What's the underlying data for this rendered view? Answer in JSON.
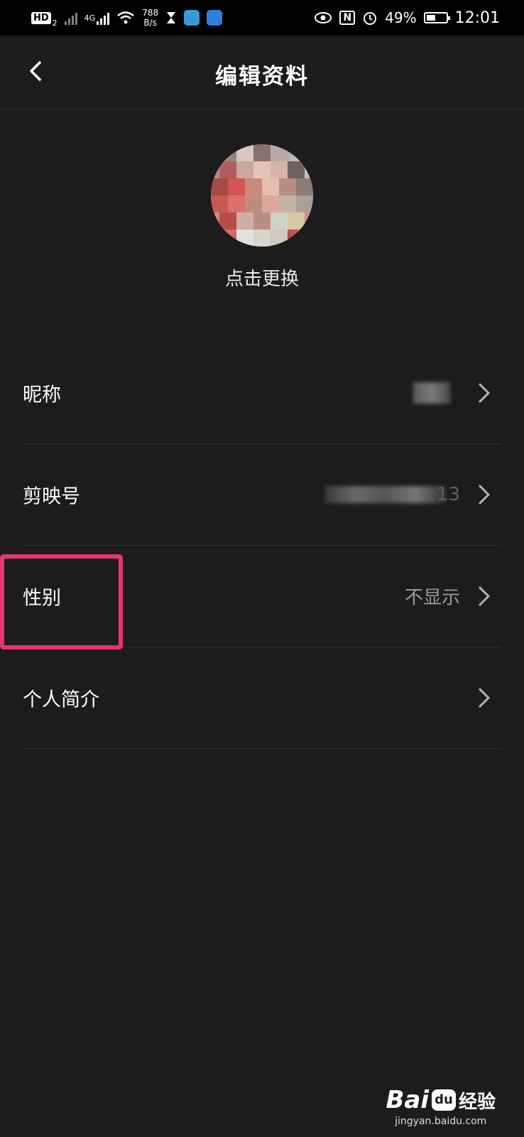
{
  "status_bar": {
    "hd_badge": "HD",
    "hd_sub": "2",
    "network": "4G",
    "net_speed_value": "788",
    "net_speed_unit": "B/s",
    "battery": "49%",
    "battery_level": 0.49,
    "time": "12:01",
    "nfc": "N"
  },
  "header": {
    "title": "编辑资料",
    "back_icon": "chevron-left-icon"
  },
  "avatar": {
    "change_label": "点击更换"
  },
  "rows": [
    {
      "label": "昵称",
      "value": ""
    },
    {
      "label": "剪映号",
      "value": "13"
    },
    {
      "label": "性别",
      "value": "不显示"
    },
    {
      "label": "个人简介",
      "value": ""
    }
  ],
  "colors": {
    "background": "#1c1c1d",
    "highlight": "#e8336d",
    "secondary_text": "#9a9a9c"
  },
  "watermark": {
    "brand": "Bai",
    "brand_mid": "du",
    "brand_cn": "经验",
    "url": "jingyan.baidu.com"
  }
}
